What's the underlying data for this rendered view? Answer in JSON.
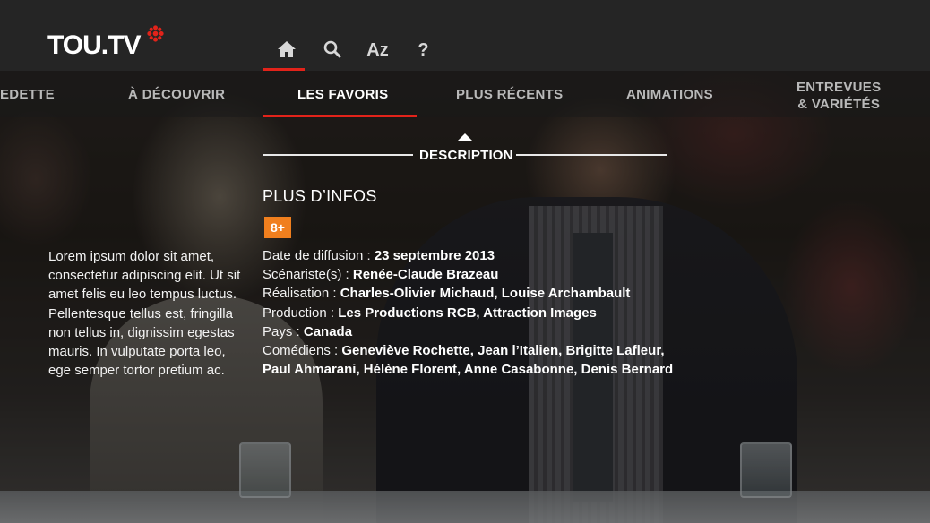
{
  "header": {
    "logo_text": "TOU.TV",
    "logo_mark": "cbc-gem-icon",
    "accent": "#e2231a",
    "nav_icons": [
      {
        "name": "home-icon",
        "label": ""
      },
      {
        "name": "search-icon",
        "label": ""
      },
      {
        "name": "az-index",
        "label": "Az"
      },
      {
        "name": "help-icon",
        "label": "?"
      }
    ]
  },
  "categories": [
    {
      "label": "EDETTE"
    },
    {
      "label": "À DÉCOUVRIR"
    },
    {
      "label": "LES FAVORIS",
      "active": true
    },
    {
      "label": "PLUS RÉCENTS"
    },
    {
      "label": "ANIMATIONS"
    },
    {
      "label_line1": "ENTREVUES",
      "label_line2": "& VARIÉTÉS"
    }
  ],
  "section": {
    "label": "DESCRIPTION"
  },
  "synopsis": "Lorem ipsum dolor sit amet, consectetur adipiscing elit. Ut sit amet felis eu leo tempus luctus. Pellentesque tellus est, fringilla non tellus in, dignissim egestas mauris. In vulputate porta leo, ege semper tortor pretium ac.",
  "info": {
    "title": "PLUS D’INFOS",
    "rating": "8+",
    "rating_color": "#f07f1e",
    "rows": [
      {
        "key": "Date de diffusion : ",
        "value": "23 septembre 2013"
      },
      {
        "key": "Scénariste(s) : ",
        "value": "Renée-Claude Brazeau"
      },
      {
        "key": "Réalisation : ",
        "value": "Charles-Olivier Michaud, Louise Archambault"
      },
      {
        "key": "Production : ",
        "value": "Les Productions RCB, Attraction Images"
      },
      {
        "key": "Pays : ",
        "value": "Canada"
      },
      {
        "key": "Comédiens : ",
        "value": "Geneviève Rochette, Jean l’Italien, Brigitte Lafleur, Paul Ahmarani, Hélène Florent, Anne Casabonne, Denis Bernard"
      }
    ]
  }
}
